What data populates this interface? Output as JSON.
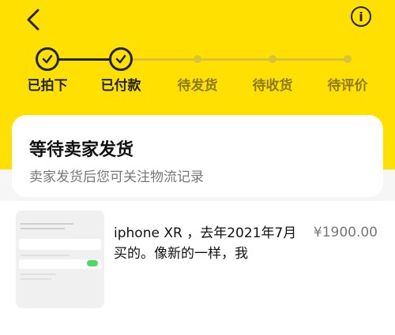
{
  "header": {
    "back_icon": "chevron-left-icon",
    "info_icon": "info-circle-icon"
  },
  "steps": [
    {
      "label": "已拍下",
      "state": "done"
    },
    {
      "label": "已付款",
      "state": "done"
    },
    {
      "label": "待发货",
      "state": "todo"
    },
    {
      "label": "待收货",
      "state": "todo"
    },
    {
      "label": "待评价",
      "state": "todo"
    }
  ],
  "status": {
    "title": "等待卖家发货",
    "subtitle": "卖家发货后您可关注物流记录"
  },
  "item": {
    "title": "iphone XR ，去年2021年7月买的。像新的一样，我",
    "price": "¥1900.00"
  },
  "colors": {
    "accent": "#ffe000",
    "done": "#222222",
    "todo": "#8a7a18"
  }
}
